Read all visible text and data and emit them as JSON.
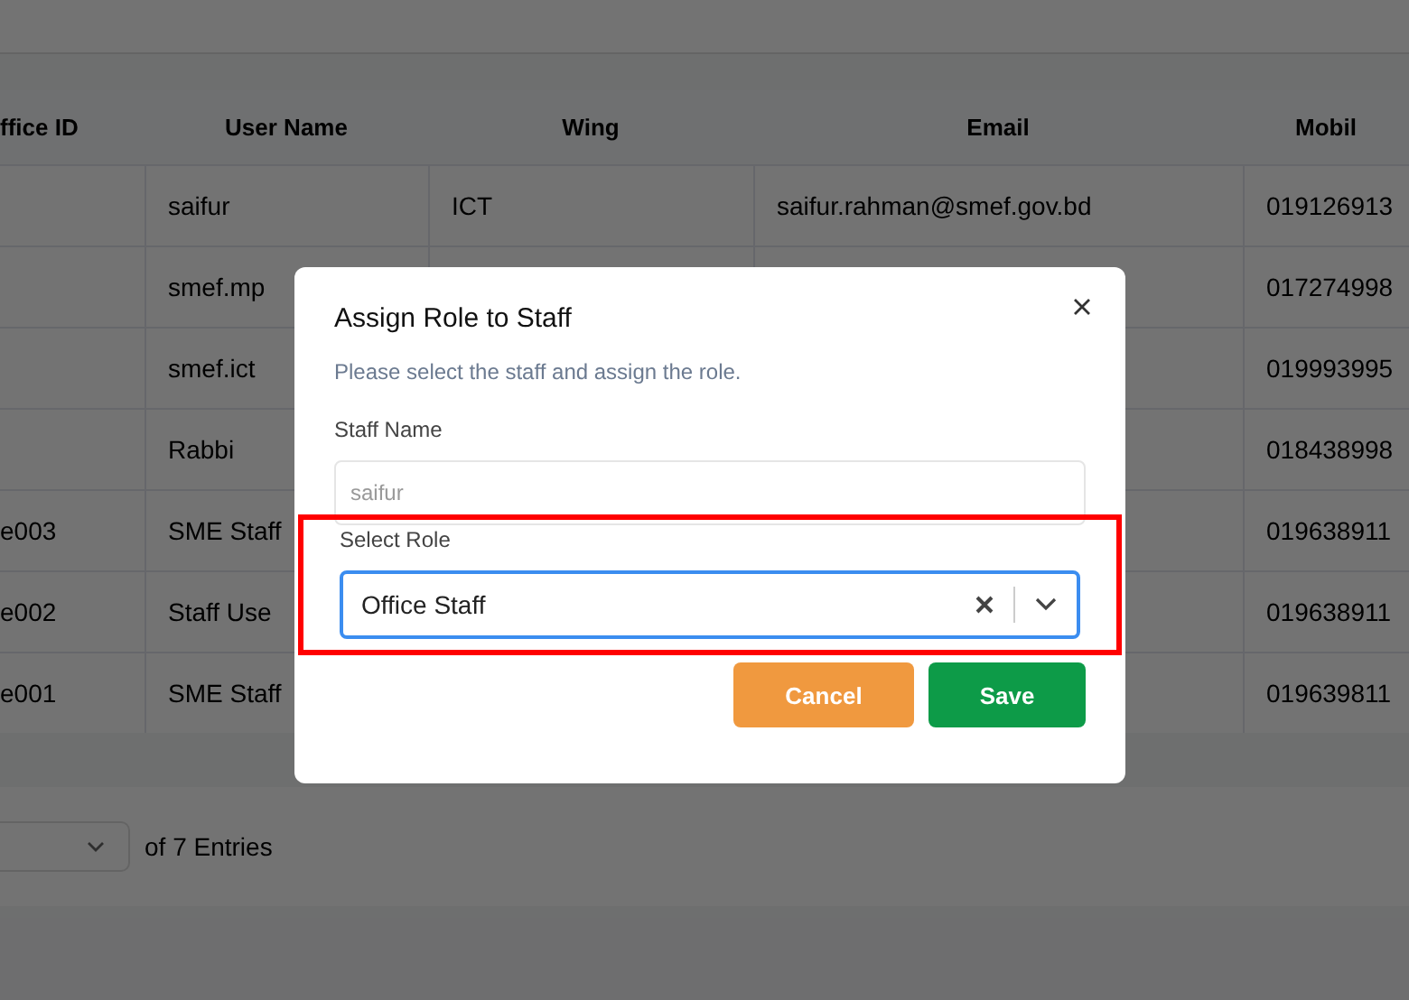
{
  "table": {
    "columns": [
      "ffice ID",
      "User Name",
      "Wing",
      "Email",
      "Mobil"
    ],
    "rows": [
      {
        "cells": [
          "",
          "saifur",
          "ICT",
          "saifur.rahman@smef.gov.bd",
          "019126913"
        ]
      },
      {
        "cells": [
          "",
          "smef.mp",
          "",
          "",
          "017274998"
        ]
      },
      {
        "cells": [
          "",
          "smef.ict",
          "",
          "",
          "019993995"
        ]
      },
      {
        "cells": [
          "",
          "Rabbi",
          "",
          "",
          "018438998"
        ]
      },
      {
        "cells": [
          "e003",
          "SME Staff",
          "",
          "",
          "019638911"
        ]
      },
      {
        "cells": [
          "e002",
          "Staff Use",
          "",
          "",
          "019638911"
        ]
      },
      {
        "cells": [
          "e001",
          "SME Staff",
          "",
          "",
          "019639811"
        ]
      }
    ]
  },
  "footer": {
    "entries_text": "of 7 Entries"
  },
  "dialog": {
    "title": "Assign Role to Staff",
    "subtitle": "Please select the staff and assign the role.",
    "staff_label": "Staff Name",
    "staff_placeholder": "saifur",
    "role_label": "Select Role",
    "role_value": "Office Staff",
    "role_highlighted": true,
    "buttons": [
      {
        "label": "Cancel",
        "kind": "cancel"
      },
      {
        "label": "Save",
        "kind": "save"
      }
    ]
  }
}
